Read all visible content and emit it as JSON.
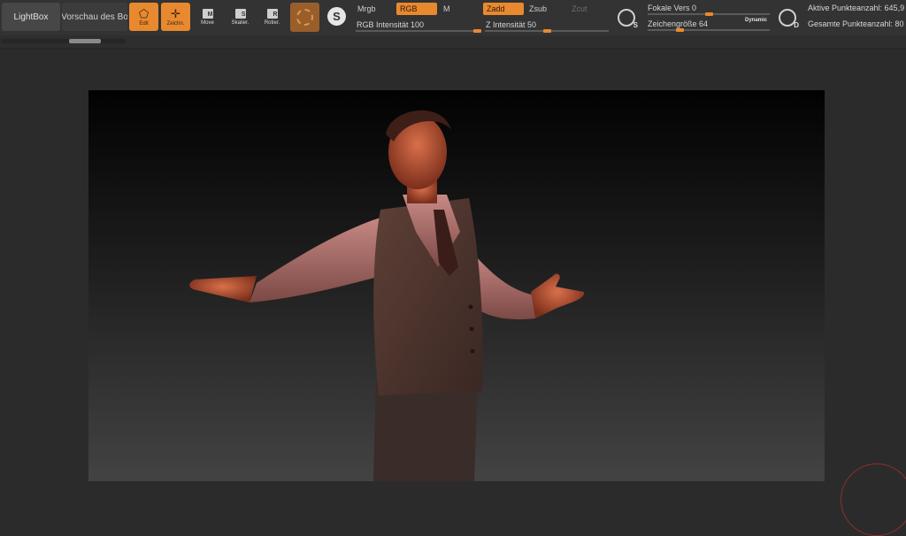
{
  "toolbar": {
    "lightbox_label": "LightBox",
    "preview_label": "Vorschau des Bo",
    "edit_label": "Edit",
    "draw_label": "Zeichn.",
    "move_label": "Move",
    "move_key": "M",
    "scale_label": "Skalier.",
    "scale_key": "S",
    "rotate_label": "Rotier.",
    "rotate_key": "R",
    "sphere_letter": "S"
  },
  "mode": {
    "mrgb_label": "Mrgb",
    "rgb_label": "RGB",
    "m_label": "M",
    "rgb_intensity_label": "RGB Intensität",
    "rgb_intensity_value": "100",
    "zadd_label": "Zadd",
    "zsub_label": "Zsub",
    "zcut_label": "Zcut",
    "z_intensity_label": "Z Intensität",
    "z_intensity_value": "50"
  },
  "brush": {
    "focal_label": "Fokale Vers",
    "focal_value": "0",
    "draw_size_label": "Zeichengröße",
    "draw_size_value": "64",
    "dynamic_label": "Dynamic",
    "s_icon_letter": "S",
    "d_icon_letter": "D"
  },
  "stats": {
    "active_points_label": "Aktive Punkteanzahl: 645,9",
    "total_points_label": "Gesamte Punkteanzahl: 80"
  },
  "sliders": {
    "rgb_intensity": 100,
    "z_intensity": 50,
    "focal": 0,
    "draw_size": 64
  },
  "colors": {
    "accent": "#e8892f",
    "toolbar_bg": "#333333",
    "canvas_bg": "#2b2b2b"
  }
}
